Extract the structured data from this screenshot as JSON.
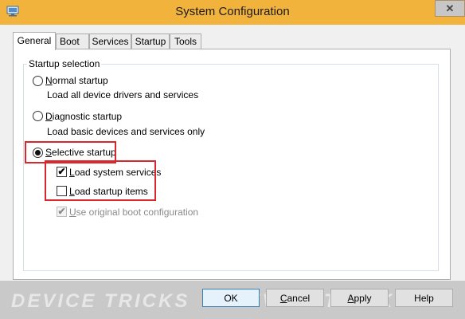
{
  "window": {
    "title": "System Configuration",
    "close_glyph": "✕"
  },
  "tabs": [
    {
      "label": "General",
      "active": true
    },
    {
      "label": "Boot",
      "active": false
    },
    {
      "label": "Services",
      "active": false
    },
    {
      "label": "Startup",
      "active": false
    },
    {
      "label": "Tools",
      "active": false
    }
  ],
  "startup_selection": {
    "group_label": "Startup selection",
    "normal": {
      "label_u": "N",
      "label_rest": "ormal startup",
      "desc": "Load all device drivers and services",
      "selected": false
    },
    "diagnostic": {
      "label_u": "D",
      "label_rest": "iagnostic startup",
      "desc": "Load basic devices and services only",
      "selected": false
    },
    "selective": {
      "label_u": "S",
      "label_rest": "elective startup",
      "selected": true
    },
    "options": {
      "load_system_services": {
        "label_u": "L",
        "label_rest": "oad system services",
        "checked": true
      },
      "load_startup_items": {
        "label_u": "L",
        "label_rest": "oad startup items",
        "checked": false
      },
      "use_original_boot": {
        "label_u": "U",
        "label_rest": "se original boot configuration",
        "checked": true,
        "disabled": true
      }
    }
  },
  "buttons": {
    "ok": "OK",
    "cancel_u": "C",
    "cancel_rest": "ancel",
    "apply_u": "A",
    "apply_rest": "pply",
    "help": "Help"
  },
  "watermark": {
    "text": "DEVICE TRICKS"
  },
  "colors": {
    "titlebar": "#f2b33d",
    "highlight": "#d9272e",
    "panel": "#ffffff"
  }
}
